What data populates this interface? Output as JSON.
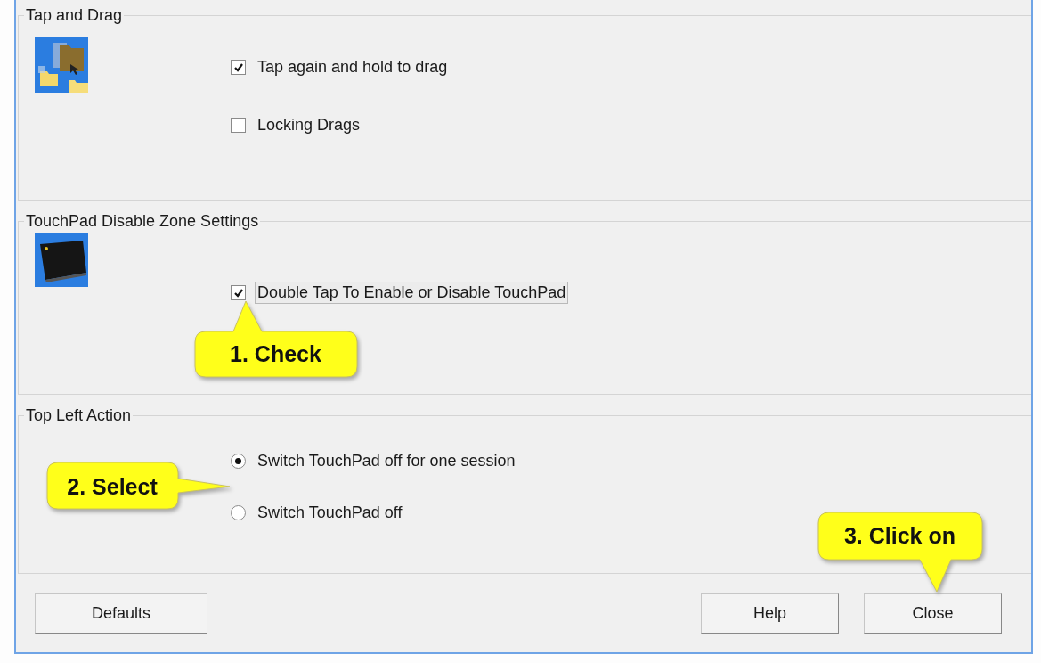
{
  "groups": [
    {
      "title": "Tap and Drag",
      "options": [
        {
          "kind": "checkbox",
          "label": "Tap again and hold to drag",
          "checked": true,
          "focused": false
        },
        {
          "kind": "checkbox",
          "label": "Locking Drags",
          "checked": false,
          "focused": false
        }
      ]
    },
    {
      "title": "TouchPad Disable Zone Settings",
      "options": [
        {
          "kind": "checkbox",
          "label": "Double Tap To Enable or Disable TouchPad",
          "checked": true,
          "focused": true
        }
      ]
    },
    {
      "title": "Top Left Action",
      "options": [
        {
          "kind": "radio",
          "label": "Switch TouchPad off for one session",
          "selected": true
        },
        {
          "kind": "radio",
          "label": "Switch TouchPad off",
          "selected": false
        }
      ]
    }
  ],
  "buttons": [
    {
      "label": "Defaults"
    },
    {
      "label": "Help"
    },
    {
      "label": "Close"
    }
  ],
  "callouts": [
    {
      "text": "1. Check"
    },
    {
      "text": "2. Select"
    },
    {
      "text": "3. Click on"
    }
  ]
}
